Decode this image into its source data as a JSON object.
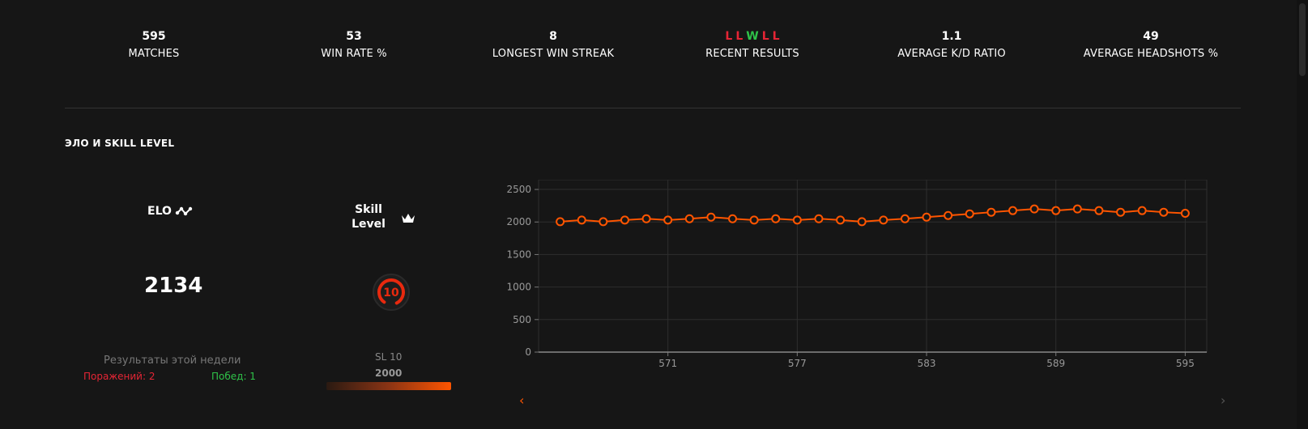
{
  "stats": [
    {
      "value": "595",
      "label": "MATCHES"
    },
    {
      "value": "53",
      "label": "WIN RATE %"
    },
    {
      "value": "8",
      "label": "LONGEST WIN STREAK"
    },
    {
      "value": "",
      "label": "RECENT RESULTS"
    },
    {
      "value": "1.1",
      "label": "AVERAGE K/D RATIO"
    },
    {
      "value": "49",
      "label": "AVERAGE HEADSHOTS %"
    }
  ],
  "recent_results": [
    "L",
    "L",
    "W",
    "L",
    "L"
  ],
  "colors": {
    "win": "#2fc349",
    "loss": "#e52535",
    "accent": "#ff5500",
    "background": "#161616"
  },
  "section": {
    "title": "ЭЛО И SKILL LEVEL"
  },
  "elo": {
    "label": "ELO",
    "value": "2134",
    "icon": "elo-trend-icon"
  },
  "skill": {
    "label_line1": "Skill",
    "label_line2": "Level",
    "level": "10",
    "icon": "crown-icon",
    "sl_text": "SL 10",
    "sl_elo": "2000",
    "progress": 1.0
  },
  "week": {
    "title": "Результаты этой недели",
    "losses": "Поражений: 2",
    "wins": "Побед: 1"
  },
  "nav": {
    "prev": "‹",
    "next": "›"
  },
  "chart_data": {
    "type": "line",
    "x": [
      566,
      567,
      568,
      569,
      570,
      571,
      572,
      573,
      574,
      575,
      576,
      577,
      578,
      579,
      580,
      581,
      582,
      583,
      584,
      585,
      586,
      587,
      588,
      589,
      590,
      591,
      592,
      593,
      594,
      595
    ],
    "y": [
      2005,
      2030,
      2005,
      2030,
      2050,
      2030,
      2050,
      2075,
      2050,
      2030,
      2050,
      2030,
      2050,
      2030,
      2005,
      2030,
      2050,
      2075,
      2100,
      2125,
      2150,
      2175,
      2200,
      2175,
      2200,
      2175,
      2150,
      2175,
      2150,
      2134
    ],
    "xticks": [
      "571",
      "577",
      "583",
      "589",
      "595"
    ],
    "yticks": [
      "0",
      "500",
      "1000",
      "1500",
      "2000",
      "2500"
    ],
    "ylim": [
      0,
      2650
    ],
    "xlim": [
      565,
      596
    ],
    "grid": true
  }
}
